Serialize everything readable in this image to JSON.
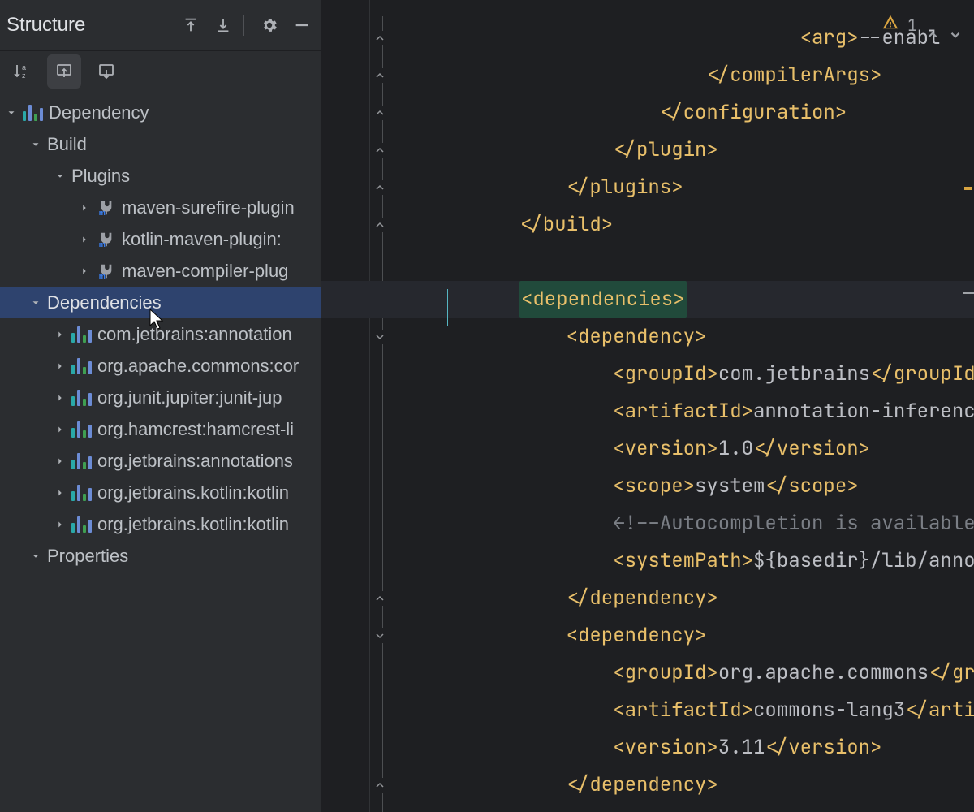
{
  "sidebar": {
    "title": "Structure",
    "tree": {
      "root": {
        "icon": "bars",
        "label": "Dependency"
      },
      "build": {
        "label": "Build"
      },
      "plugins": {
        "label": "Plugins"
      },
      "pluginItems": [
        {
          "label": "maven-surefire-plugin"
        },
        {
          "label": "kotlin-maven-plugin:"
        },
        {
          "label": "maven-compiler-plug"
        }
      ],
      "dependencies": {
        "label": "Dependencies"
      },
      "depItems": [
        {
          "label": "com.jetbrains:annotation"
        },
        {
          "label": "org.apache.commons:cor"
        },
        {
          "label": "org.junit.jupiter:junit-jup"
        },
        {
          "label": "org.hamcrest:hamcrest-li"
        },
        {
          "label": "org.jetbrains:annotations"
        },
        {
          "label": "org.jetbrains.kotlin:kotlin"
        },
        {
          "label": "org.jetbrains.kotlin:kotlin"
        }
      ],
      "properties": {
        "label": "Properties"
      }
    }
  },
  "inspections": {
    "count": "1"
  },
  "code": {
    "lines": [
      {
        "indent": 17,
        "open": "<arg>",
        "text": "--enabl",
        "type": "tagtext"
      },
      {
        "indent": 13,
        "close": "</compilerArgs>"
      },
      {
        "indent": 11,
        "close": "</configuration>"
      },
      {
        "indent": 9,
        "close": "</plugin>"
      },
      {
        "indent": 7,
        "close": "</plugins>"
      },
      {
        "indent": 5,
        "close": "</build>"
      },
      {
        "blank": true
      },
      {
        "indent": 5,
        "open": "<dependencies>",
        "highlight": true
      },
      {
        "indent": 7,
        "open": "<dependency>"
      },
      {
        "indent": 9,
        "open": "<groupId>",
        "text": "com.jetbrains",
        "close": "</groupId>"
      },
      {
        "indent": 9,
        "open": "<artifactId>",
        "text": "annotation-inference"
      },
      {
        "indent": 9,
        "open": "<version>",
        "text": "1.0",
        "close": "</version>"
      },
      {
        "indent": 9,
        "open": "<scope>",
        "text": "system",
        "close": "</scope>"
      },
      {
        "indent": 9,
        "comment": "←!––Autocompletion is available o"
      },
      {
        "indent": 9,
        "open": "<systemPath>",
        "text": "${basedir}/lib/annota"
      },
      {
        "indent": 7,
        "close": "</dependency>"
      },
      {
        "indent": 7,
        "open": "<dependency>"
      },
      {
        "indent": 9,
        "open": "<groupId>",
        "text": "org.apache.commons",
        "closepartial": "</grou"
      },
      {
        "indent": 9,
        "open": "<artifactId>",
        "text": "commons-lang3",
        "closepartial": "</artifa"
      },
      {
        "indent": 9,
        "open": "<version>",
        "text": "3.11",
        "close": "</version>"
      },
      {
        "indent": 7,
        "close": "</dependency>"
      }
    ]
  }
}
